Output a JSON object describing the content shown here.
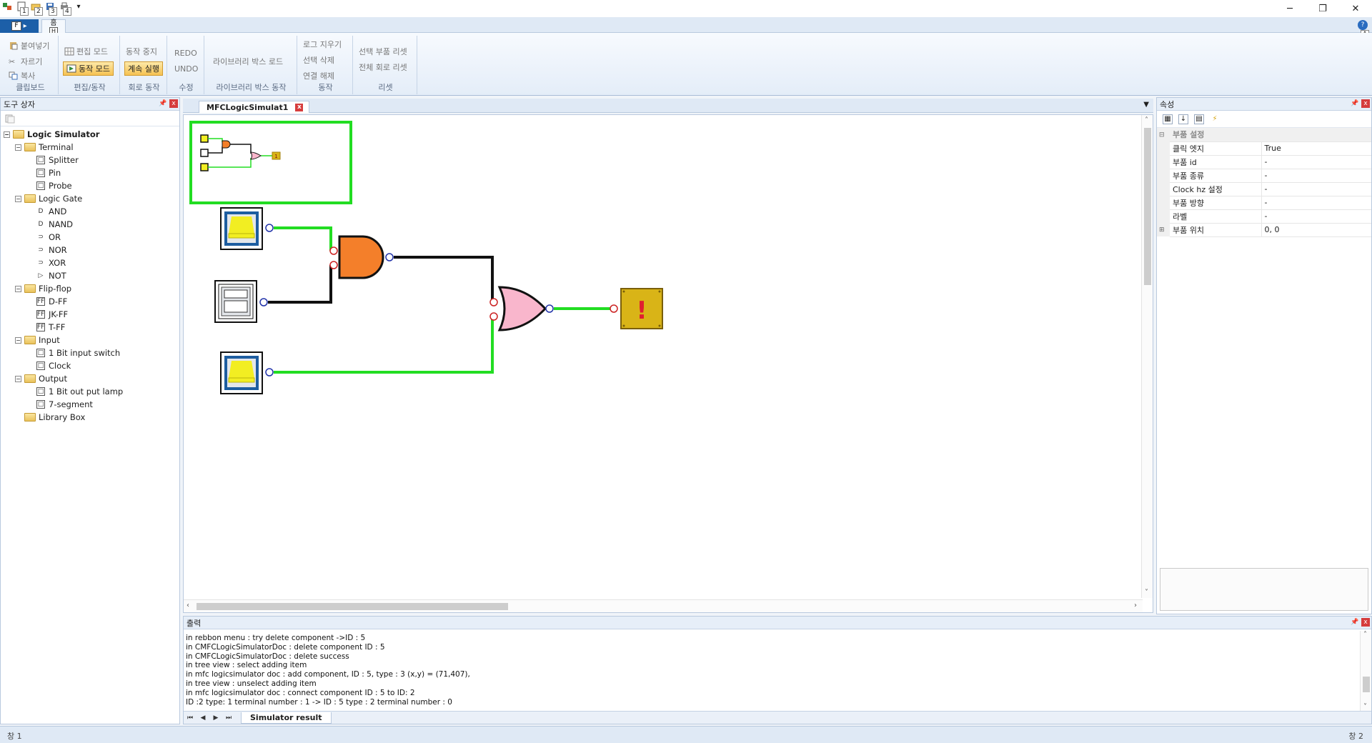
{
  "quick_access": {
    "keytips": [
      "1",
      "2",
      "3",
      "4"
    ],
    "dropdown_glyph": "▾"
  },
  "window_controls": {
    "minimize": "─",
    "restore": "❐",
    "close": "✕"
  },
  "ribbon_tabs": {
    "file_label": "F",
    "home_label": "홈",
    "home_keytip": "H",
    "help_keytip": "A"
  },
  "ribbon": {
    "clipboard": {
      "paste": "붙여넣기",
      "cut": "자르기",
      "copy": "복사",
      "label": "클립보드"
    },
    "edit_run": {
      "edit_mode": "편집 모드",
      "run_mode": "동작 모드",
      "label": "편집/동작"
    },
    "circuit": {
      "stop": "동작 중지",
      "continuous": "계속 실행",
      "label": "회로 동작"
    },
    "modify": {
      "redo": "REDO",
      "undo": "UNDO",
      "label": "수정"
    },
    "library": {
      "load": "라이브러리 박스 로드",
      "label": "라이브러리 박스 동작"
    },
    "action": {
      "clear_log": "로그 지우기",
      "delete_selection": "선택 삭제",
      "disconnect": "연결 해제",
      "label": "동작"
    },
    "reset": {
      "reset_selected": "선택 부품 리셋",
      "reset_all": "전체 회로 리셋",
      "label": "리셋"
    }
  },
  "toolbox": {
    "title": "도구 상자",
    "root": "Logic Simulator",
    "groups": [
      {
        "name": "Terminal",
        "items": [
          {
            "label": "Splitter",
            "icon": "□"
          },
          {
            "label": "Pin",
            "icon": "□"
          },
          {
            "label": "Probe",
            "icon": "□"
          }
        ]
      },
      {
        "name": "Logic Gate",
        "items": [
          {
            "label": "AND",
            "icon": "D"
          },
          {
            "label": "NAND",
            "icon": "D"
          },
          {
            "label": "OR",
            "icon": "⊃"
          },
          {
            "label": "NOR",
            "icon": "⊃"
          },
          {
            "label": "XOR",
            "icon": "⊃"
          },
          {
            "label": "NOT",
            "icon": "▷"
          }
        ]
      },
      {
        "name": "Flip-flop",
        "items": [
          {
            "label": "D-FF",
            "icon": "FF"
          },
          {
            "label": "JK-FF",
            "icon": "FF"
          },
          {
            "label": "T-FF",
            "icon": "FF"
          }
        ]
      },
      {
        "name": "Input",
        "items": [
          {
            "label": "1 Bit input switch",
            "icon": "□"
          },
          {
            "label": "Clock",
            "icon": "□"
          }
        ]
      },
      {
        "name": "Output",
        "items": [
          {
            "label": "1 Bit out put lamp",
            "icon": "□"
          },
          {
            "label": "7-segment",
            "icon": "□"
          }
        ]
      },
      {
        "name": "Library Box",
        "items": []
      }
    ]
  },
  "document": {
    "tab_title": "MFCLogicSimulat1",
    "dropdown_glyph": "▼"
  },
  "circuit": {
    "lamp_symbol": "!",
    "minimap_lamp_label": "1",
    "wire_on_color": "#22dd22",
    "wire_off_color": "#111111",
    "and_gate_color": "#f47f2a",
    "or_gate_color": "#f9b6cc",
    "lamp_color": "#d9b417",
    "switch_on_color": "#f2ee22",
    "switch_frame_color": "#1d5da0",
    "input_pin_color": "#cc2222",
    "output_pin_color": "#2233aa"
  },
  "properties": {
    "title": "속성",
    "category": "부품 설정",
    "rows": [
      {
        "name": "클릭 엣지",
        "value": "True"
      },
      {
        "name": "부품 id",
        "value": "-"
      },
      {
        "name": "부품 종류",
        "value": "-"
      },
      {
        "name": "Clock hz 설정",
        "value": "-"
      },
      {
        "name": "부품 방향",
        "value": "-"
      },
      {
        "name": "라벨",
        "value": "-"
      },
      {
        "name": "부품 위치",
        "value": "0, 0",
        "expandable": true
      }
    ]
  },
  "output": {
    "title": "출력",
    "lines": [
      "in rebbon menu : try delete component ->ID : 5",
      "in CMFCLogicSimulatorDoc : delete component ID : 5",
      "in CMFCLogicSimulatorDoc : delete success",
      "in tree view : select adding item",
      "in mfc logicsimulator doc : add component, ID : 5, type : 3 (x,y) = (71,407),",
      "in tree view : unselect adding item",
      "in mfc logicsimulator doc : connect component ID : 5 to ID: 2",
      "ID :2 type: 1 terminal number : 1 -> ID : 5 type : 2 terminal number : 0"
    ],
    "tab": "Simulator result"
  },
  "status": {
    "left": "창 1",
    "right": "창 2"
  }
}
